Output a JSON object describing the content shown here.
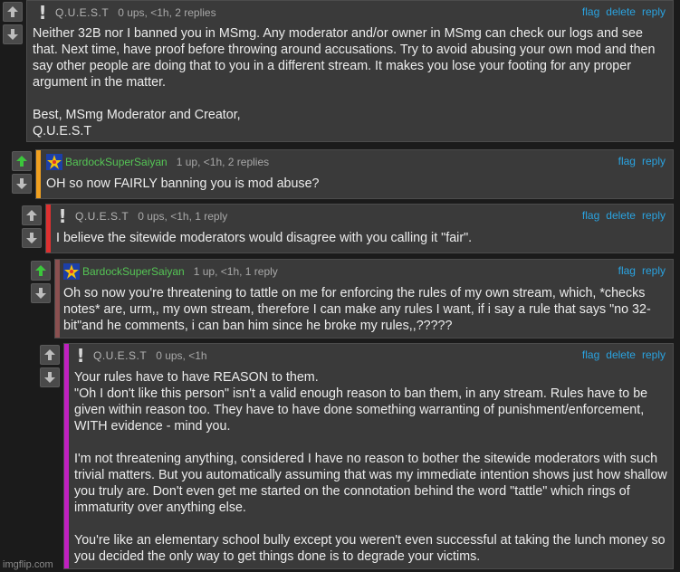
{
  "colors": {
    "background": "#1b1b1b",
    "panel": "#3a3a3a",
    "link": "#2aa3e0",
    "username_green": "#55c555",
    "bar_orange": "#f0a020",
    "bar_red": "#dd3030",
    "bar_brown": "#8a5050",
    "bar_magenta": "#c020c0",
    "upvote_active": "#3cc63c"
  },
  "comments": [
    {
      "user": "Q.U.E.S.T",
      "meta": "0 ups, <1h, 2 replies",
      "actions": [
        "flag",
        "delete",
        "reply"
      ],
      "text": "Neither 32B nor I banned you in MSmg. Any moderator and/or owner in MSmg can check our logs and see that. Next time, have proof before throwing around accusations. Try to avoid abusing your own mod and then say other people are doing that to you in a different stream. It makes you lose your footing for any proper argument in the matter.\n\nBest, MSmg Moderator and Creator,\nQ.U.E.S.T"
    },
    {
      "user": "BardockSuperSaiyan",
      "meta": "1 up, <1h, 2 replies",
      "actions": [
        "flag",
        "reply"
      ],
      "text": "OH so now FAIRLY banning you is mod abuse?"
    },
    {
      "user": "Q.U.E.S.T",
      "meta": "0 ups, <1h, 1 reply",
      "actions": [
        "flag",
        "delete",
        "reply"
      ],
      "text": "I believe the sitewide moderators would disagree with you calling it \"fair\"."
    },
    {
      "user": "BardockSuperSaiyan",
      "meta": "1 up, <1h, 1 reply",
      "actions": [
        "flag",
        "reply"
      ],
      "text": "Oh so now you're threatening to tattle on me for enforcing the rules of my own stream, which, *checks notes* are, urm,, my own stream, therefore I can make any rules I want, if i say a rule that says \"no 32-bit\"and he comments, i can ban him since he broke my rules,,?????"
    },
    {
      "user": "Q.U.E.S.T",
      "meta": "0 ups, <1h",
      "actions": [
        "flag",
        "delete",
        "reply"
      ],
      "text": "Your rules have to have REASON to them.\n\"Oh I don't like this person\" isn't a valid enough reason to ban them, in any stream. Rules have to be given within reason too. They have to have done something warranting of punishment/enforcement, WITH evidence - mind you.\n\nI'm not threatening anything, considered I have no reason to bother the sitewide moderators with such trivial matters. But you automatically assuming that was my immediate intention shows just how shallow you truly are. Don't even get me started on the connotation behind the word \"tattle\" which rings of immaturity over anything else.\n\nYou're like an elementary school bully except you weren't even successful at taking the lunch money so you decided the only way to get things done is to degrade your victims."
    }
  ],
  "watermark": "imgflip.com"
}
